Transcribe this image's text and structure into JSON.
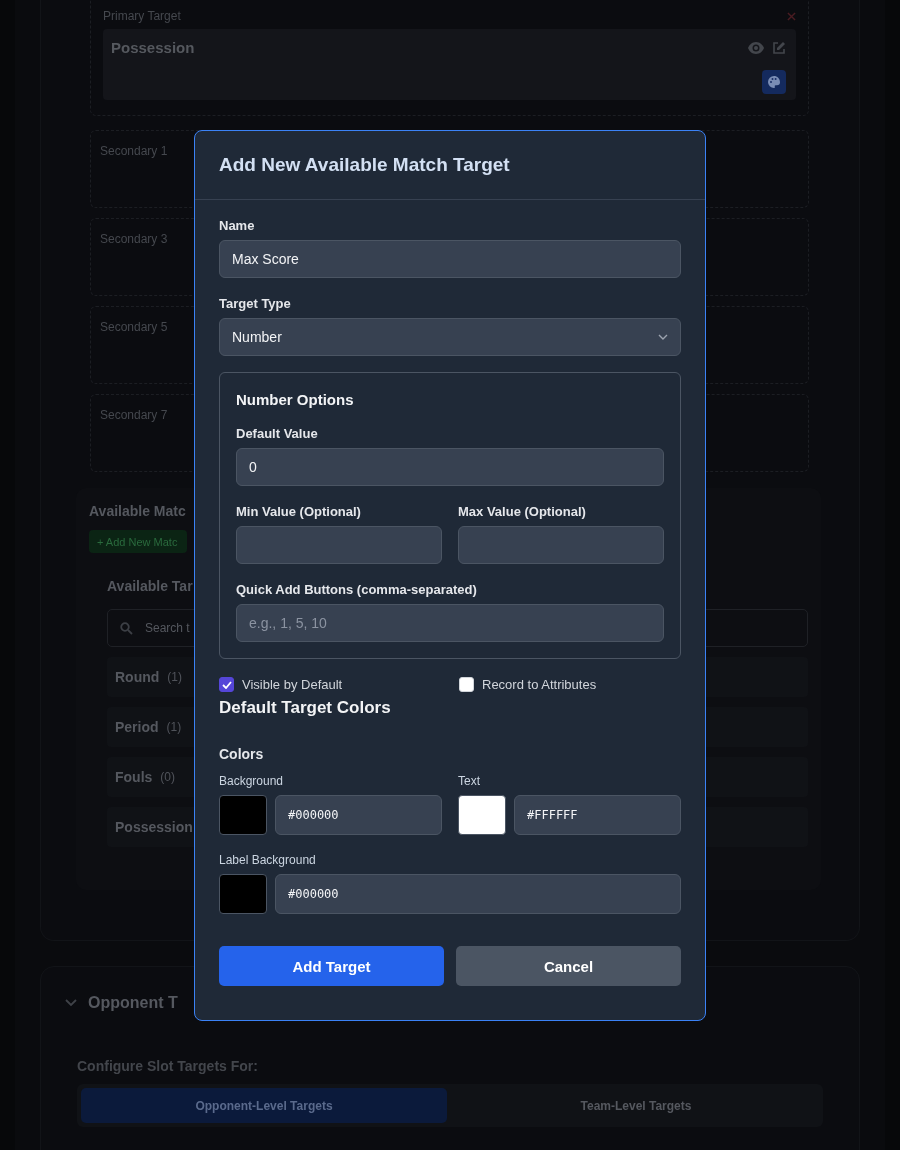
{
  "background": {
    "primary": {
      "label": "Primary Target",
      "target": "Possession"
    },
    "secondary": [
      {
        "label": "Secondary 1"
      },
      {
        "label": "Secondary 3"
      },
      {
        "label": "Secondary 5"
      },
      {
        "label": "Secondary 7"
      }
    ],
    "available": {
      "title": "Available Matc",
      "add_button": "+ Add New Matc",
      "list_title": "Available Tar",
      "search_placeholder": "Search t",
      "targets": [
        {
          "name": "Round",
          "count": "(1)"
        },
        {
          "name": "Period",
          "count": "(1)"
        },
        {
          "name": "Fouls",
          "count": "(0)"
        },
        {
          "name": "Possession"
        }
      ]
    },
    "opponent": {
      "title": "Opponent T",
      "configure_label": "Configure Slot Targets For:",
      "tabs": [
        {
          "label": "Opponent-Level Targets",
          "selected": true
        },
        {
          "label": "Team-Level Targets",
          "selected": false
        }
      ]
    }
  },
  "modal": {
    "title": "Add New Available Match Target",
    "name": {
      "label": "Name",
      "value": "Max Score"
    },
    "target_type": {
      "label": "Target Type",
      "value": "Number"
    },
    "number_options": {
      "title": "Number Options",
      "default_value": {
        "label": "Default Value",
        "value": "0"
      },
      "min_value": {
        "label": "Min Value (Optional)"
      },
      "max_value": {
        "label": "Max Value (Optional)"
      },
      "quick_add": {
        "label": "Quick Add Buttons (comma-separated)",
        "placeholder": "e.g., 1, 5, 10"
      }
    },
    "checkboxes": [
      {
        "label": "Visible by Default",
        "checked": true
      },
      {
        "label": "Record to Attributes",
        "checked": false
      }
    ],
    "colors_title": "Default Target Colors",
    "colors_label": "Colors",
    "color_fields": [
      {
        "label": "Background",
        "value": "#000000",
        "color": "#000000"
      },
      {
        "label": "Text",
        "value": "#FFFFFF",
        "color": "#ffffff"
      },
      {
        "label": "Label Background",
        "value": "#000000",
        "color": "#000000"
      }
    ],
    "buttons": [
      {
        "label": "Add Target",
        "kind": "primary"
      },
      {
        "label": "Cancel",
        "kind": "secondary"
      }
    ]
  }
}
